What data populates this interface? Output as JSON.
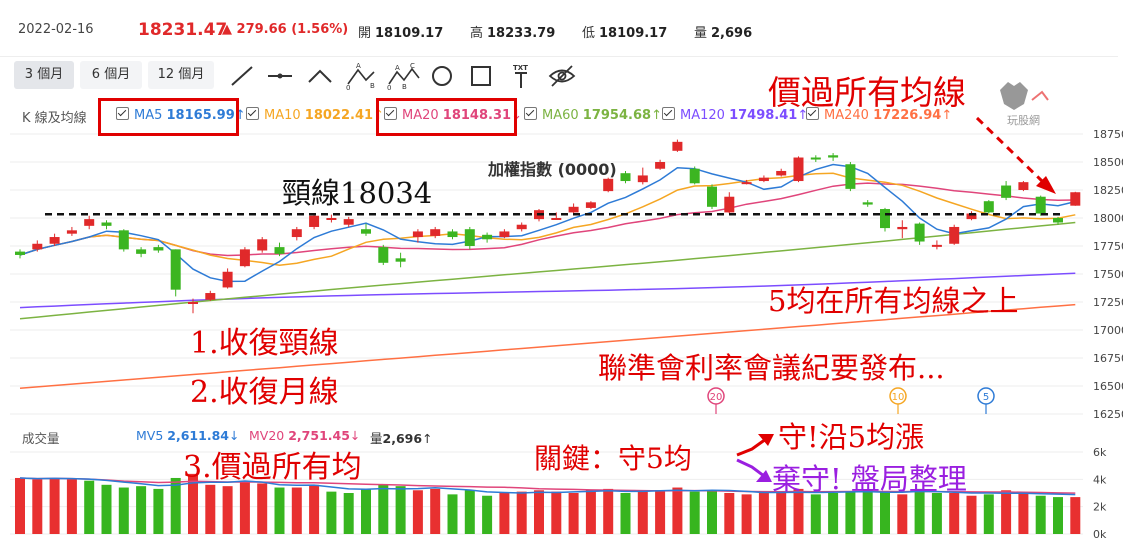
{
  "info": {
    "date": "2022-02-16",
    "price": "18231.47",
    "change": "279.66 (1.56%)",
    "open_label": "開",
    "open": "18109.17",
    "high_label": "高",
    "high": "18233.79",
    "low_label": "低",
    "low": "18109.17",
    "vol_label": "量",
    "vol": "2,696"
  },
  "toolbar": {
    "periods": [
      "3 個月",
      "6 個月",
      "12 個月"
    ],
    "tools": [
      "line-tool-icon",
      "horizontal-line-tool-icon",
      "angle-tool-icon",
      "abc-pattern-icon",
      "abcd-pattern-icon",
      "circle-tool-icon",
      "rectangle-tool-icon",
      "text-tool-icon",
      "hide-drawings-icon"
    ],
    "txt_label": "TXT",
    "pattern_a": [
      "0",
      "A",
      "B"
    ],
    "pattern_b": [
      "0",
      "A",
      "B",
      "C"
    ]
  },
  "ma_legend": {
    "title": "K 線及均線",
    "items": [
      {
        "label": "MA5",
        "value": "18165.99",
        "arrow": "↑",
        "color": "#2e7bd6"
      },
      {
        "label": "MA10",
        "value": "18022.41",
        "arrow": "↑",
        "color": "#f5a623"
      },
      {
        "label": "MA20",
        "value": "18148.31",
        "arrow": "↓",
        "color": "#e0457b"
      },
      {
        "label": "MA60",
        "value": "17954.68",
        "arrow": "↑",
        "color": "#7cb342"
      },
      {
        "label": "MA120",
        "value": "17498.41",
        "arrow": "↑",
        "color": "#7c4dff"
      },
      {
        "label": "MA240",
        "value": "17226.94",
        "arrow": "↑",
        "color": "#ff7043"
      }
    ]
  },
  "vol_legend": {
    "title": "成交量",
    "mv5_label": "MV5",
    "mv5": "2,611.84",
    "mv5_arrow": "↓",
    "mv20_label": "MV20",
    "mv20": "2,751.45",
    "mv20_arrow": "↓",
    "vol_label": "量",
    "vol": "2,696",
    "vol_arrow": "↑"
  },
  "watermark": "玩股網",
  "annotations": {
    "index_name": "加權指數 (0000)",
    "neckline": "頸線18034",
    "above_all": "價過所有均線",
    "ma5_above": "5均在所有均線之上",
    "step1": "1.收復頸線",
    "step2": "2.收復月線",
    "step3": "3.價過所有均",
    "fed": "聯準會利率會議紀要發布...",
    "key": "關鍵：守5均",
    "hold": "守!沿5均漲",
    "lose": "棄守! 盤局整理"
  },
  "markers": [
    "20",
    "10",
    "5"
  ],
  "chart_data": {
    "type": "candlestick",
    "y_ticks": [
      "18750",
      "18500",
      "18250",
      "18000",
      "17750",
      "17500",
      "17250",
      "17000",
      "16750",
      "16500",
      "16250"
    ],
    "ylim": [
      16250,
      18750
    ],
    "vol_ticks": [
      "6k",
      "4k",
      "2k",
      "0k"
    ],
    "vol_lim": [
      0,
      6
    ],
    "neckline": 18034,
    "candles": [
      [
        17700,
        17670,
        17720,
        17640
      ],
      [
        17720,
        17770,
        17800,
        17700
      ],
      [
        17770,
        17830,
        17860,
        17750
      ],
      [
        17860,
        17890,
        17920,
        17840
      ],
      [
        17930,
        17990,
        18020,
        17900
      ],
      [
        17960,
        17930,
        17980,
        17900
      ],
      [
        17890,
        17720,
        17900,
        17700
      ],
      [
        17720,
        17680,
        17740,
        17650
      ],
      [
        17740,
        17710,
        17760,
        17690
      ],
      [
        17720,
        17360,
        17720,
        17300
      ],
      [
        17240,
        17250,
        17280,
        17150
      ],
      [
        17270,
        17330,
        17350,
        17260
      ],
      [
        17380,
        17520,
        17550,
        17370
      ],
      [
        17570,
        17720,
        17740,
        17560
      ],
      [
        17710,
        17810,
        17830,
        17690
      ],
      [
        17740,
        17680,
        17780,
        17660
      ],
      [
        17830,
        17900,
        17920,
        17800
      ],
      [
        17920,
        18020,
        18040,
        17900
      ],
      [
        17990,
        18000,
        18030,
        17960
      ],
      [
        17940,
        17990,
        18010,
        17920
      ],
      [
        17900,
        17860,
        17950,
        17840
      ],
      [
        17740,
        17600,
        17760,
        17580
      ],
      [
        17640,
        17610,
        17690,
        17560
      ],
      [
        17830,
        17880,
        17900,
        17780
      ],
      [
        17840,
        17900,
        17920,
        17820
      ],
      [
        17880,
        17830,
        17900,
        17810
      ],
      [
        17900,
        17750,
        17920,
        17720
      ],
      [
        17850,
        17810,
        17870,
        17780
      ],
      [
        17830,
        17880,
        17900,
        17820
      ],
      [
        17900,
        17940,
        17960,
        17880
      ],
      [
        17990,
        18070,
        18080,
        17970
      ],
      [
        18000,
        18000,
        18050,
        17990
      ],
      [
        18050,
        18100,
        18130,
        18030
      ],
      [
        18090,
        18140,
        18150,
        18080
      ],
      [
        18240,
        18350,
        18360,
        18230
      ],
      [
        18400,
        18330,
        18420,
        18310
      ],
      [
        18320,
        18380,
        18450,
        18300
      ],
      [
        18440,
        18500,
        18520,
        18430
      ],
      [
        18600,
        18680,
        18700,
        18590
      ],
      [
        18440,
        18310,
        18460,
        18300
      ],
      [
        18280,
        18100,
        18300,
        18080
      ],
      [
        18050,
        18190,
        18230,
        18040
      ],
      [
        18310,
        18320,
        18340,
        18300
      ],
      [
        18330,
        18360,
        18380,
        18320
      ],
      [
        18380,
        18420,
        18440,
        18370
      ],
      [
        18330,
        18540,
        18550,
        18320
      ],
      [
        18540,
        18530,
        18560,
        18500
      ],
      [
        18560,
        18540,
        18580,
        18510
      ],
      [
        18480,
        18260,
        18500,
        18240
      ],
      [
        18140,
        18120,
        18160,
        18100
      ],
      [
        18080,
        17910,
        18090,
        17880
      ],
      [
        17900,
        17920,
        17980,
        17820
      ],
      [
        17950,
        17790,
        17960,
        17760
      ],
      [
        17760,
        17760,
        17800,
        17720
      ],
      [
        17770,
        17920,
        17940,
        17760
      ],
      [
        17990,
        18040,
        18060,
        17980
      ],
      [
        18150,
        18050,
        18160,
        18040
      ],
      [
        18290,
        18180,
        18330,
        18160
      ],
      [
        18250,
        18320,
        18330,
        18240
      ],
      [
        18190,
        18040,
        18200,
        18020
      ],
      [
        18000,
        17960,
        18010,
        17940
      ],
      [
        18110,
        18230,
        18234,
        18109
      ]
    ],
    "volumes": [
      [
        4.1,
        1
      ],
      [
        4.0,
        1
      ],
      [
        4.1,
        1
      ],
      [
        4.0,
        1
      ],
      [
        3.9,
        0
      ],
      [
        3.6,
        0
      ],
      [
        3.4,
        0
      ],
      [
        3.5,
        0
      ],
      [
        3.3,
        0
      ],
      [
        4.1,
        0
      ],
      [
        4.4,
        1
      ],
      [
        3.6,
        1
      ],
      [
        3.5,
        1
      ],
      [
        3.8,
        1
      ],
      [
        3.7,
        1
      ],
      [
        3.4,
        0
      ],
      [
        3.4,
        1
      ],
      [
        3.6,
        1
      ],
      [
        3.1,
        0
      ],
      [
        3.0,
        0
      ],
      [
        3.3,
        0
      ],
      [
        3.6,
        0
      ],
      [
        3.5,
        0
      ],
      [
        3.2,
        1
      ],
      [
        3.3,
        1
      ],
      [
        2.9,
        0
      ],
      [
        3.2,
        0
      ],
      [
        2.8,
        0
      ],
      [
        3.0,
        1
      ],
      [
        3.1,
        1
      ],
      [
        3.2,
        1
      ],
      [
        3.1,
        1
      ],
      [
        3.0,
        1
      ],
      [
        3.2,
        1
      ],
      [
        3.3,
        1
      ],
      [
        3.0,
        0
      ],
      [
        3.1,
        1
      ],
      [
        3.2,
        1
      ],
      [
        3.4,
        1
      ],
      [
        3.1,
        0
      ],
      [
        3.2,
        0
      ],
      [
        3.0,
        1
      ],
      [
        2.9,
        1
      ],
      [
        3.0,
        1
      ],
      [
        3.1,
        1
      ],
      [
        3.3,
        1
      ],
      [
        2.9,
        0
      ],
      [
        3.0,
        0
      ],
      [
        3.1,
        0
      ],
      [
        3.2,
        0
      ],
      [
        3.1,
        0
      ],
      [
        2.9,
        1
      ],
      [
        3.3,
        0
      ],
      [
        3.0,
        0
      ],
      [
        3.0,
        1
      ],
      [
        2.8,
        1
      ],
      [
        2.9,
        0
      ],
      [
        3.2,
        1
      ],
      [
        3.0,
        1
      ],
      [
        2.8,
        0
      ],
      [
        2.7,
        0
      ],
      [
        2.7,
        1
      ]
    ]
  }
}
